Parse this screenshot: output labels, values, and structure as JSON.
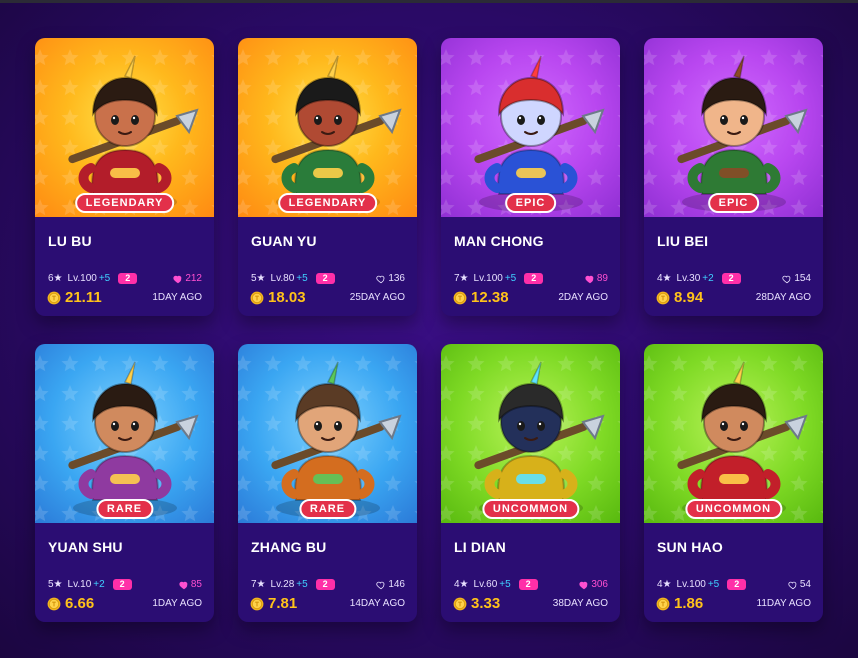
{
  "cards": [
    {
      "name": "LU BU",
      "rarity": "LEGENDARY",
      "stars": "6★",
      "level": "Lv.100",
      "plus": "+5",
      "badge": "2",
      "likes": "212",
      "liked": true,
      "price": "21.11",
      "ago": "1DAY AGO",
      "theme": "legendary",
      "palette": {
        "skin": "#c9714b",
        "armor": "#b31d2a",
        "hair": "#2b1b12",
        "accent": "#ffd04a"
      }
    },
    {
      "name": "GUAN YU",
      "rarity": "LEGENDARY",
      "stars": "5★",
      "level": "Lv.80",
      "plus": "+5",
      "badge": "2",
      "likes": "136",
      "liked": false,
      "price": "18.03",
      "ago": "25DAY AGO",
      "theme": "legendary",
      "palette": {
        "skin": "#b04a33",
        "armor": "#2a7c3a",
        "hair": "#1a1a1a",
        "accent": "#ffd04a"
      }
    },
    {
      "name": "MAN CHONG",
      "rarity": "EPIC",
      "stars": "7★",
      "level": "Lv.100",
      "plus": "+5",
      "badge": "2",
      "likes": "89",
      "liked": true,
      "price": "12.38",
      "ago": "2DAY AGO",
      "theme": "epic",
      "palette": {
        "skin": "#cfd6ff",
        "armor": "#2a52d6",
        "hair": "#d92e2e",
        "accent": "#ffd04a"
      }
    },
    {
      "name": "LIU BEI",
      "rarity": "EPIC",
      "stars": "4★",
      "level": "Lv.30",
      "plus": "+2",
      "badge": "2",
      "likes": "154",
      "liked": false,
      "price": "8.94",
      "ago": "28DAY AGO",
      "theme": "epic",
      "palette": {
        "skin": "#f0b58a",
        "armor": "#2e7a34",
        "hair": "#2a1b12",
        "accent": "#8a4a26"
      }
    },
    {
      "name": "YUAN SHU",
      "rarity": "RARE",
      "stars": "5★",
      "level": "Lv.10",
      "plus": "+2",
      "badge": "2",
      "likes": "85",
      "liked": true,
      "price": "6.66",
      "ago": "1DAY AGO",
      "theme": "rare",
      "palette": {
        "skin": "#d08a5e",
        "armor": "#8f3aa0",
        "hair": "#2a1b12",
        "accent": "#ffd04a"
      }
    },
    {
      "name": "ZHANG BU",
      "rarity": "RARE",
      "stars": "7★",
      "level": "Lv.28",
      "plus": "+5",
      "badge": "2",
      "likes": "146",
      "liked": false,
      "price": "7.81",
      "ago": "14DAY AGO",
      "theme": "rare",
      "palette": {
        "skin": "#e1a579",
        "armor": "#d46d1f",
        "hair": "#5a3b25",
        "accent": "#5ac85c"
      }
    },
    {
      "name": "LI DIAN",
      "rarity": "UNCOMMON",
      "stars": "4★",
      "level": "Lv.60",
      "plus": "+5",
      "badge": "2",
      "likes": "306",
      "liked": true,
      "price": "3.33",
      "ago": "38DAY AGO",
      "theme": "uncommon",
      "palette": {
        "skin": "#23305a",
        "armor": "#d7b11a",
        "hair": "#2a2a2a",
        "accent": "#5de3ff"
      }
    },
    {
      "name": "SUN HAO",
      "rarity": "UNCOMMON",
      "stars": "4★",
      "level": "Lv.100",
      "plus": "+5",
      "badge": "2",
      "likes": "54",
      "liked": false,
      "price": "1.86",
      "ago": "11DAY AGO",
      "theme": "uncommon",
      "palette": {
        "skin": "#d08a5e",
        "armor": "#c21f2a",
        "hair": "#2a1b12",
        "accent": "#ffd04a"
      }
    }
  ],
  "colors": {
    "background": "#2a0a66",
    "card": "#2b0d73",
    "price": "#ffc21a",
    "plus": "#3fd0ff",
    "badge": "#ff2fa8",
    "heart_liked": "#ff4fd0",
    "rarity_tag": "#e3304a"
  },
  "icons": {
    "heart": "heart-icon",
    "coin": "coin-icon",
    "star": "star-glyph"
  }
}
